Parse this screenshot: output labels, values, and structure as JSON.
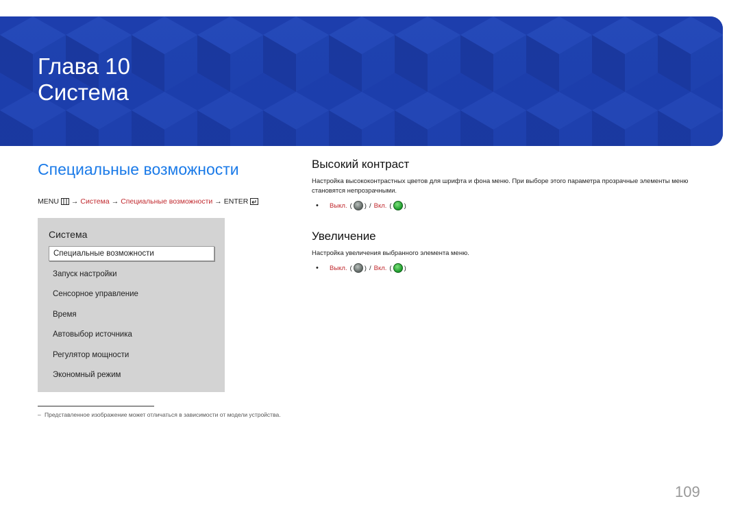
{
  "header": {
    "chapter_line1": "Глава 10",
    "chapter_line2": "Система",
    "banner_color": "#1b3aa6"
  },
  "left": {
    "section_title": "Специальные возможности",
    "breadcrumb": {
      "menu": "MENU",
      "menu_icon": "menu-button-icon",
      "arrow": "→",
      "step1": "Система",
      "step2": "Специальные возможности",
      "enter": "ENTER",
      "enter_icon": "enter-button-icon"
    },
    "menu_panel": {
      "title": "Система",
      "items": [
        "Специальные возможности",
        "Запуск настройки",
        "Сенсорное управление",
        "Время",
        "Автовыбор источника",
        "Регулятор мощности",
        "Экономный режим"
      ]
    },
    "footnote": "Представленное изображение может отличаться в зависимости от модели устройства."
  },
  "right": {
    "high_contrast": {
      "title": "Высокий контраст",
      "description": "Настройка высококонтрастных цветов для шрифта и фона меню. При выборе этого параметра прозрачные элементы меню становятся непрозрачными.",
      "off_label": "Выкл.",
      "on_label": "Вкл.",
      "separator": "/"
    },
    "zoom": {
      "title": "Увеличение",
      "description": "Настройка увеличения выбранного элемента меню.",
      "off_label": "Выкл.",
      "on_label": "Вкл.",
      "separator": "/"
    }
  },
  "page_number": "109",
  "colors": {
    "accent_blue": "#1a7ae8",
    "accent_red": "#c0282d",
    "panel_gray": "#d3d3d3"
  }
}
